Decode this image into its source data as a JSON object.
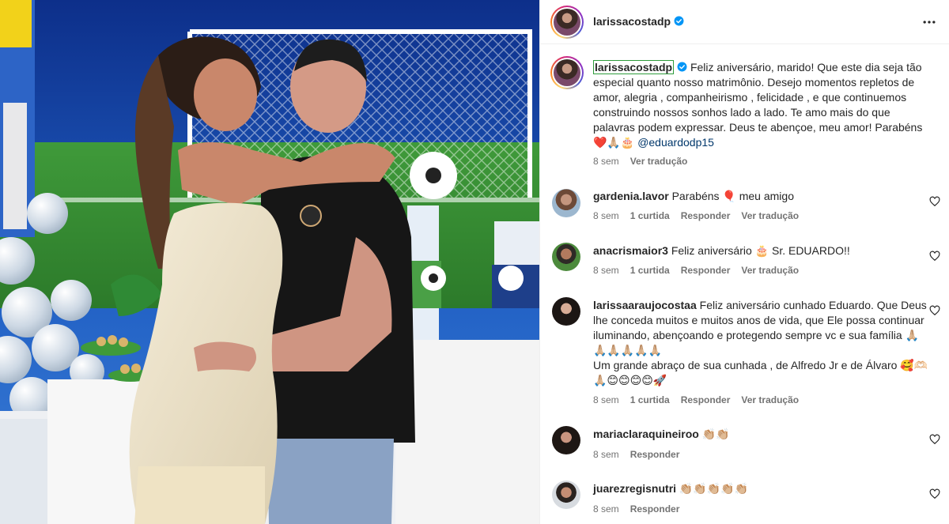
{
  "post": {
    "author": "larissacostadp",
    "more_icon": "more-horizontal-icon",
    "verified_icon": "verified-badge-icon"
  },
  "caption": {
    "author": "larissacostadp",
    "text": "Feliz aniversário, marido! Que este dia seja tão especial quanto nosso matrimônio. Desejo momentos repletos de amor, alegria , companheirismo , felicidade , e que continuemos construindo nossos sonhos lado a lado. Te amo mais do que palavras podem expressar. Deus te abençoe, meu amor! Parabéns ❤️🙏🏼🎂",
    "mention": "@eduardodp15",
    "time": "8 sem",
    "translate_label": "Ver tradução"
  },
  "comments": [
    {
      "author": "gardenia.lavor",
      "text": "Parabéns 🎈 meu amigo",
      "time": "8 sem",
      "likes": "1 curtida",
      "reply_label": "Responder",
      "translate_label": "Ver tradução"
    },
    {
      "author": "anacrismaior3",
      "text": "Feliz aniversário 🎂 Sr. EDUARDO!!",
      "time": "8 sem",
      "likes": "1 curtida",
      "reply_label": "Responder",
      "translate_label": "Ver tradução"
    },
    {
      "author": "larissaaraujocostaa",
      "text": "Feliz aniversário cunhado Eduardo. Que Deus lhe conceda muitos e muitos anos de vida, que Ele possa continuar iluminando, abençoando e protegendo sempre vc e sua família 🙏🏼🙏🏼🙏🏼🙏🏼🙏🏼🙏🏼",
      "text2": "Um grande abraço de sua cunhada , de Alfredo Jr e de Álvaro 🥰🫶🏻🙏🏼😊😊😊😊🚀",
      "time": "8 sem",
      "likes": "1 curtida",
      "reply_label": "Responder",
      "translate_label": "Ver tradução"
    },
    {
      "author": "mariaclaraquineiroo",
      "text": "👏🏼👏🏼",
      "time": "8 sem",
      "reply_label": "Responder"
    },
    {
      "author": "juarezregisnutri",
      "text": "👏🏼👏🏼👏🏼👏🏼👏🏼",
      "time": "8 sem",
      "reply_label": "Responder"
    }
  ],
  "icons": {
    "like": "heart-outline-icon"
  },
  "colors": {
    "text": "#262626",
    "muted": "#737373",
    "mention": "#00376b",
    "verified": "#0095f6",
    "highlight_border": "#2e9c3b"
  }
}
